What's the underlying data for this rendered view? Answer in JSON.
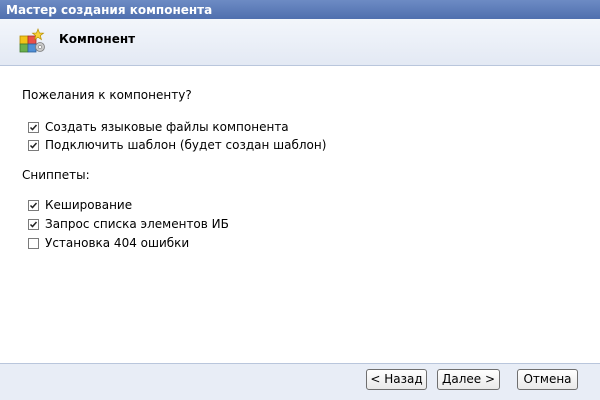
{
  "window": {
    "title": "Мастер создания компонента"
  },
  "header": {
    "title": "Компонент",
    "icon": "component-wizard-icon"
  },
  "wishes": {
    "label": "Пожелания к компоненту?",
    "options": [
      {
        "label": "Создать языковые файлы компонента",
        "checked": true
      },
      {
        "label": "Подключить шаблон (будет создан шаблон)",
        "checked": true
      }
    ]
  },
  "snippets": {
    "label": "Сниппеты:",
    "options": [
      {
        "label": "Кеширование",
        "checked": true
      },
      {
        "label": "Запрос списка элементов ИБ",
        "checked": true
      },
      {
        "label": "Установка 404 ошибки",
        "checked": false
      }
    ]
  },
  "footer": {
    "back_label": "< Назад",
    "next_label": "Далее >",
    "cancel_label": "Отмена"
  }
}
